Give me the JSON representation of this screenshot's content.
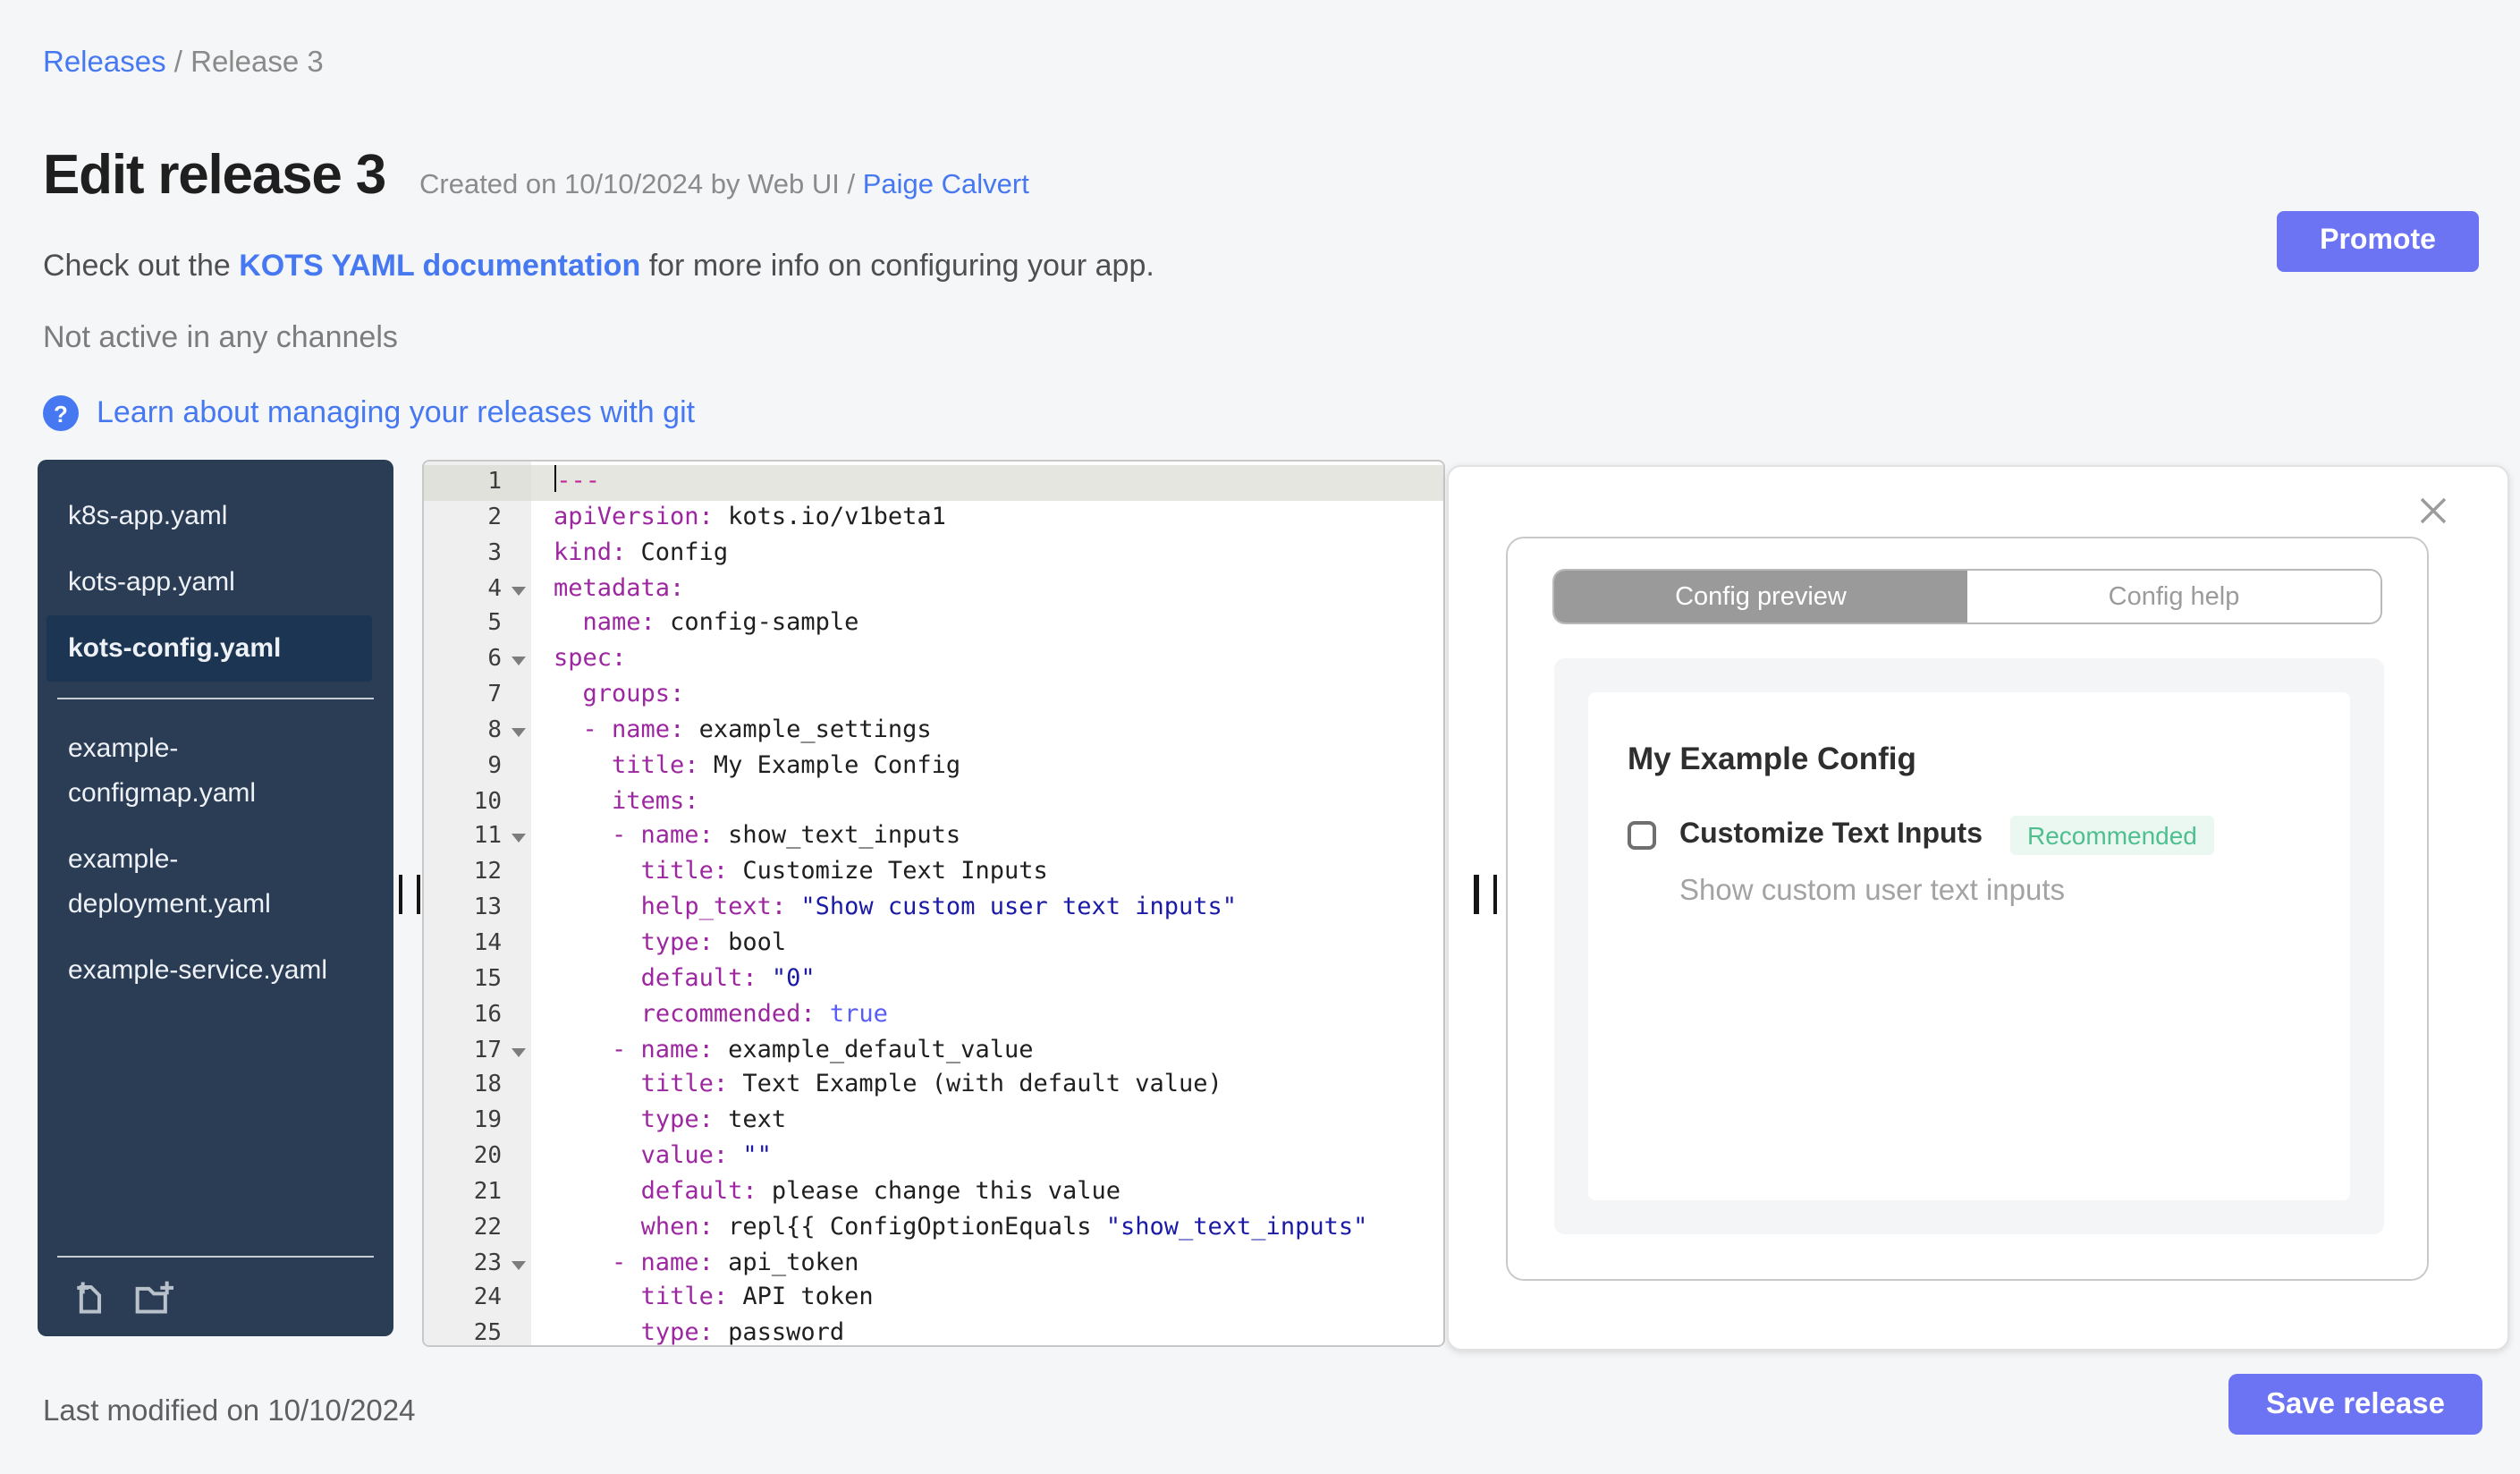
{
  "colors": {
    "accent": "#6c74f4",
    "link": "#4678f2",
    "sidebar-bg": "#2b3c55",
    "sidebar-sel": "#1c3553",
    "tab-gray": "#9a9a9a",
    "badge-green": "#4fbf90",
    "badge-bg": "#eaf8f1",
    "code-key": "#9c27a0",
    "code-str": "#1a1aa6",
    "code-bool": "#585cf6",
    "code-doc": "#c0269c",
    "code-val": "#1f1f1f"
  },
  "breadcrumb": {
    "link": "Releases",
    "separator": " / ",
    "current": "Release 3"
  },
  "header": {
    "title": "Edit release 3",
    "created_prefix": "Created on 10/10/2024 by Web UI / ",
    "created_by": "Paige Calvert",
    "docs_prefix": "Check out the ",
    "docs_link": "KOTS YAML documentation",
    "docs_suffix": " for more info on configuring your app.",
    "channel_status": "Not active in any channels",
    "help_icon": "?",
    "git_link": "Learn about managing your releases with git"
  },
  "actions": {
    "promote": "Promote",
    "save": "Save release"
  },
  "sidebar": {
    "files": [
      {
        "label": "k8s-app.yaml",
        "selected": false
      },
      {
        "label": "kots-app.yaml",
        "selected": false
      },
      {
        "label": "kots-config.yaml",
        "selected": true
      },
      {
        "divider": true
      },
      {
        "label": "example-\nconfigmap.yaml",
        "selected": false
      },
      {
        "label": "example-\ndeployment.yaml",
        "selected": false
      },
      {
        "label": "example-service.yaml",
        "selected": false
      }
    ],
    "icons": [
      "new-file-icon",
      "new-folder-icon"
    ]
  },
  "editor": {
    "lines": [
      {
        "n": 1,
        "active": true,
        "cursor": true,
        "tokens": [
          [
            "doc",
            "---"
          ]
        ]
      },
      {
        "n": 2,
        "tokens": [
          [
            "key",
            "apiVersion:"
          ],
          [
            "val",
            " kots.io/v1beta1"
          ]
        ]
      },
      {
        "n": 3,
        "tokens": [
          [
            "key",
            "kind:"
          ],
          [
            "val",
            " Config"
          ]
        ]
      },
      {
        "n": 4,
        "fold": true,
        "tokens": [
          [
            "key",
            "metadata:"
          ]
        ]
      },
      {
        "n": 5,
        "tokens": [
          [
            "val",
            "  "
          ],
          [
            "key",
            "name:"
          ],
          [
            "val",
            " config-sample"
          ]
        ]
      },
      {
        "n": 6,
        "fold": true,
        "tokens": [
          [
            "key",
            "spec:"
          ]
        ]
      },
      {
        "n": 7,
        "tokens": [
          [
            "val",
            "  "
          ],
          [
            "key",
            "groups:"
          ]
        ]
      },
      {
        "n": 8,
        "fold": true,
        "tokens": [
          [
            "val",
            "  "
          ],
          [
            "key",
            "- name:"
          ],
          [
            "val",
            " example_settings"
          ]
        ]
      },
      {
        "n": 9,
        "tokens": [
          [
            "val",
            "    "
          ],
          [
            "key",
            "title:"
          ],
          [
            "val",
            " My Example Config"
          ]
        ]
      },
      {
        "n": 10,
        "tokens": [
          [
            "val",
            "    "
          ],
          [
            "key",
            "items:"
          ]
        ]
      },
      {
        "n": 11,
        "fold": true,
        "tokens": [
          [
            "val",
            "    "
          ],
          [
            "key",
            "- name:"
          ],
          [
            "val",
            " show_text_inputs"
          ]
        ]
      },
      {
        "n": 12,
        "tokens": [
          [
            "val",
            "      "
          ],
          [
            "key",
            "title:"
          ],
          [
            "val",
            " Customize Text Inputs"
          ]
        ]
      },
      {
        "n": 13,
        "tokens": [
          [
            "val",
            "      "
          ],
          [
            "key",
            "help_text:"
          ],
          [
            "str",
            " \"Show custom user text inputs\""
          ]
        ]
      },
      {
        "n": 14,
        "tokens": [
          [
            "val",
            "      "
          ],
          [
            "key",
            "type:"
          ],
          [
            "val",
            " bool"
          ]
        ]
      },
      {
        "n": 15,
        "tokens": [
          [
            "val",
            "      "
          ],
          [
            "key",
            "default:"
          ],
          [
            "str",
            " \"0\""
          ]
        ]
      },
      {
        "n": 16,
        "tokens": [
          [
            "val",
            "      "
          ],
          [
            "key",
            "recommended:"
          ],
          [
            "bool",
            " true"
          ]
        ]
      },
      {
        "n": 17,
        "fold": true,
        "tokens": [
          [
            "val",
            "    "
          ],
          [
            "key",
            "- name:"
          ],
          [
            "val",
            " example_default_value"
          ]
        ]
      },
      {
        "n": 18,
        "tokens": [
          [
            "val",
            "      "
          ],
          [
            "key",
            "title:"
          ],
          [
            "val",
            " Text Example (with default value)"
          ]
        ]
      },
      {
        "n": 19,
        "tokens": [
          [
            "val",
            "      "
          ],
          [
            "key",
            "type:"
          ],
          [
            "val",
            " text"
          ]
        ]
      },
      {
        "n": 20,
        "tokens": [
          [
            "val",
            "      "
          ],
          [
            "key",
            "value:"
          ],
          [
            "str",
            " \"\""
          ]
        ]
      },
      {
        "n": 21,
        "tokens": [
          [
            "val",
            "      "
          ],
          [
            "key",
            "default:"
          ],
          [
            "val",
            " please change this value"
          ]
        ]
      },
      {
        "n": 22,
        "tokens": [
          [
            "val",
            "      "
          ],
          [
            "key",
            "when:"
          ],
          [
            "val",
            " repl{{ ConfigOptionEquals "
          ],
          [
            "str",
            "\"show_text_inputs\""
          ]
        ]
      },
      {
        "n": 23,
        "fold": true,
        "tokens": [
          [
            "val",
            "    "
          ],
          [
            "key",
            "- name:"
          ],
          [
            "val",
            " api_token"
          ]
        ]
      },
      {
        "n": 24,
        "tokens": [
          [
            "val",
            "      "
          ],
          [
            "key",
            "title:"
          ],
          [
            "val",
            " API token"
          ]
        ]
      },
      {
        "n": 25,
        "tokens": [
          [
            "val",
            "      "
          ],
          [
            "key",
            "type:"
          ],
          [
            "val",
            " password"
          ]
        ]
      }
    ]
  },
  "preview": {
    "tabs": [
      {
        "label": "Config preview",
        "active": true
      },
      {
        "label": "Config help",
        "active": false
      }
    ],
    "group_title": "My Example Config",
    "item_label": "Customize Text Inputs",
    "item_badge": "Recommended",
    "item_help": "Show custom user text inputs",
    "item_checked": false
  },
  "footer": {
    "last_modified": "Last modified on 10/10/2024"
  }
}
